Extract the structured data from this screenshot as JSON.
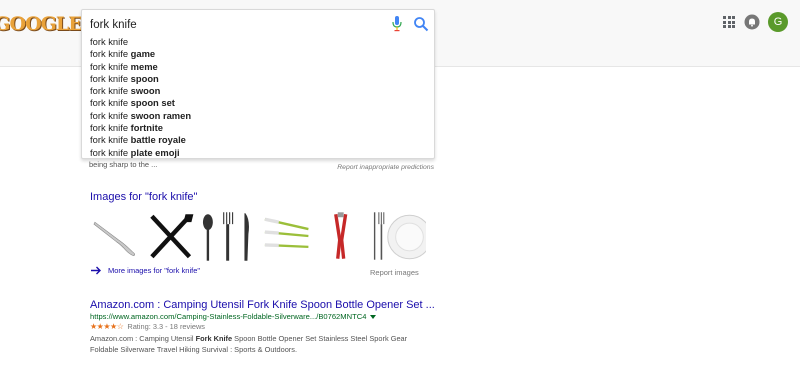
{
  "header": {
    "logo_text": "GOOGLE",
    "search": {
      "value": "fork knife"
    },
    "avatar_letter": "G"
  },
  "suggestions": [
    {
      "prefix": "fork knife",
      "suffix": ""
    },
    {
      "prefix": "fork knife",
      "suffix": "game"
    },
    {
      "prefix": "fork knife",
      "suffix": "meme"
    },
    {
      "prefix": "fork knife",
      "suffix": "spoon"
    },
    {
      "prefix": "fork knife",
      "suffix": "swoon"
    },
    {
      "prefix": "fork knife",
      "suffix": "spoon set"
    },
    {
      "prefix": "fork knife",
      "suffix": "swoon ramen"
    },
    {
      "prefix": "fork knife",
      "suffix": "fortnite"
    },
    {
      "prefix": "fork knife",
      "suffix": "battle royale"
    },
    {
      "prefix": "fork knife",
      "suffix": "plate emoji"
    }
  ],
  "snippet_tail": "being sharp to the ...",
  "report_predictions": "Report inappropriate predictions",
  "images": {
    "heading": "Images for \"fork knife\"",
    "more_label": "More images for \"fork knife\"",
    "report_label": "Report images",
    "thumbnails": [
      "fork-thumb",
      "crossed-fork-knife-thumb",
      "spoon-fork-knife-thumb",
      "plastic-cutlery-thumb",
      "red-tongs-thumb",
      "plate-cutlery-thumb"
    ]
  },
  "result": {
    "title": "Amazon.com : Camping Utensil Fork Knife Spoon Bottle Opener Set ...",
    "url": "https://www.amazon.com/Camping-Stainless-Foldable-Silverware.../B0762MNTC4",
    "stars": "★★★★☆",
    "rating_text": "Rating: 3.3 - 18 reviews",
    "desc_before": "Amazon.com : Camping Utensil ",
    "desc_bold": "Fork Knife",
    "desc_after": " Spoon Bottle Opener Set Stainless Steel Spork Gear Foldable Silverware Travel Hiking Survival : Sports & Outdoors."
  },
  "colors": {
    "link": "#1a0dab",
    "url_green": "#006621",
    "star_orange": "#e7711b",
    "avatar_green": "#5a9a2b"
  }
}
